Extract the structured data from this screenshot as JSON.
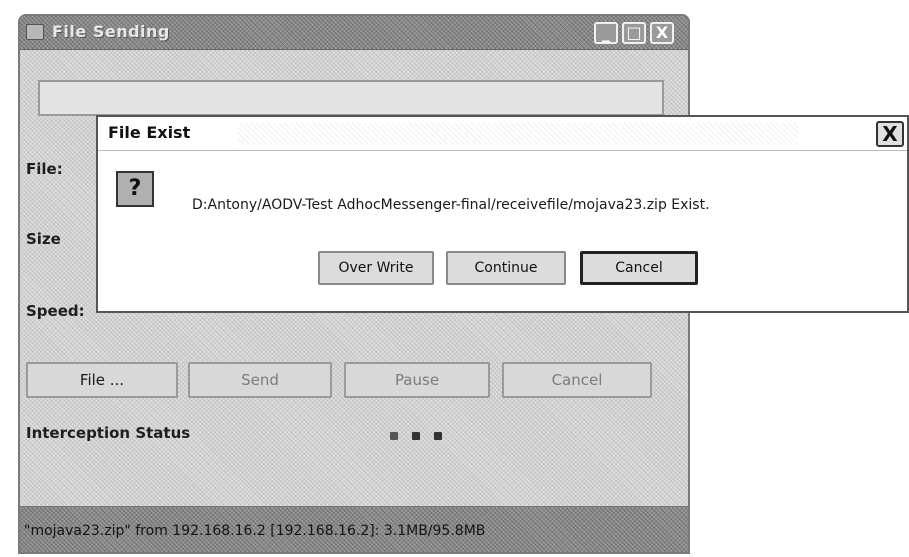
{
  "main_window": {
    "title": "File Sending",
    "controls": {
      "minimize": "_",
      "maximize": "□",
      "close": "X"
    },
    "path_value": "",
    "labels": {
      "file": "File:",
      "size": "Size",
      "speed": "Speed:"
    },
    "buttons": {
      "file": "File ...",
      "send": "Send",
      "pause": "Pause",
      "cancel": "Cancel"
    },
    "interception_label": "Interception Status",
    "status_text": "\"mojava23.zip\" from 192.168.16.2 [192.168.16.2]: 3.1MB/95.8MB"
  },
  "dialog": {
    "title": "File Exist",
    "close": "X",
    "icon": "?",
    "message": "D:Antony/AODV-Test AdhocMessenger-final/receivefile/mojava23.zip Exist.",
    "buttons": {
      "overwrite": "Over Write",
      "continue": "Continue",
      "cancel": "Cancel"
    }
  },
  "icons": [
    "app-icon",
    "question-icon",
    "close-icon",
    "minimize-icon",
    "maximize-icon"
  ]
}
